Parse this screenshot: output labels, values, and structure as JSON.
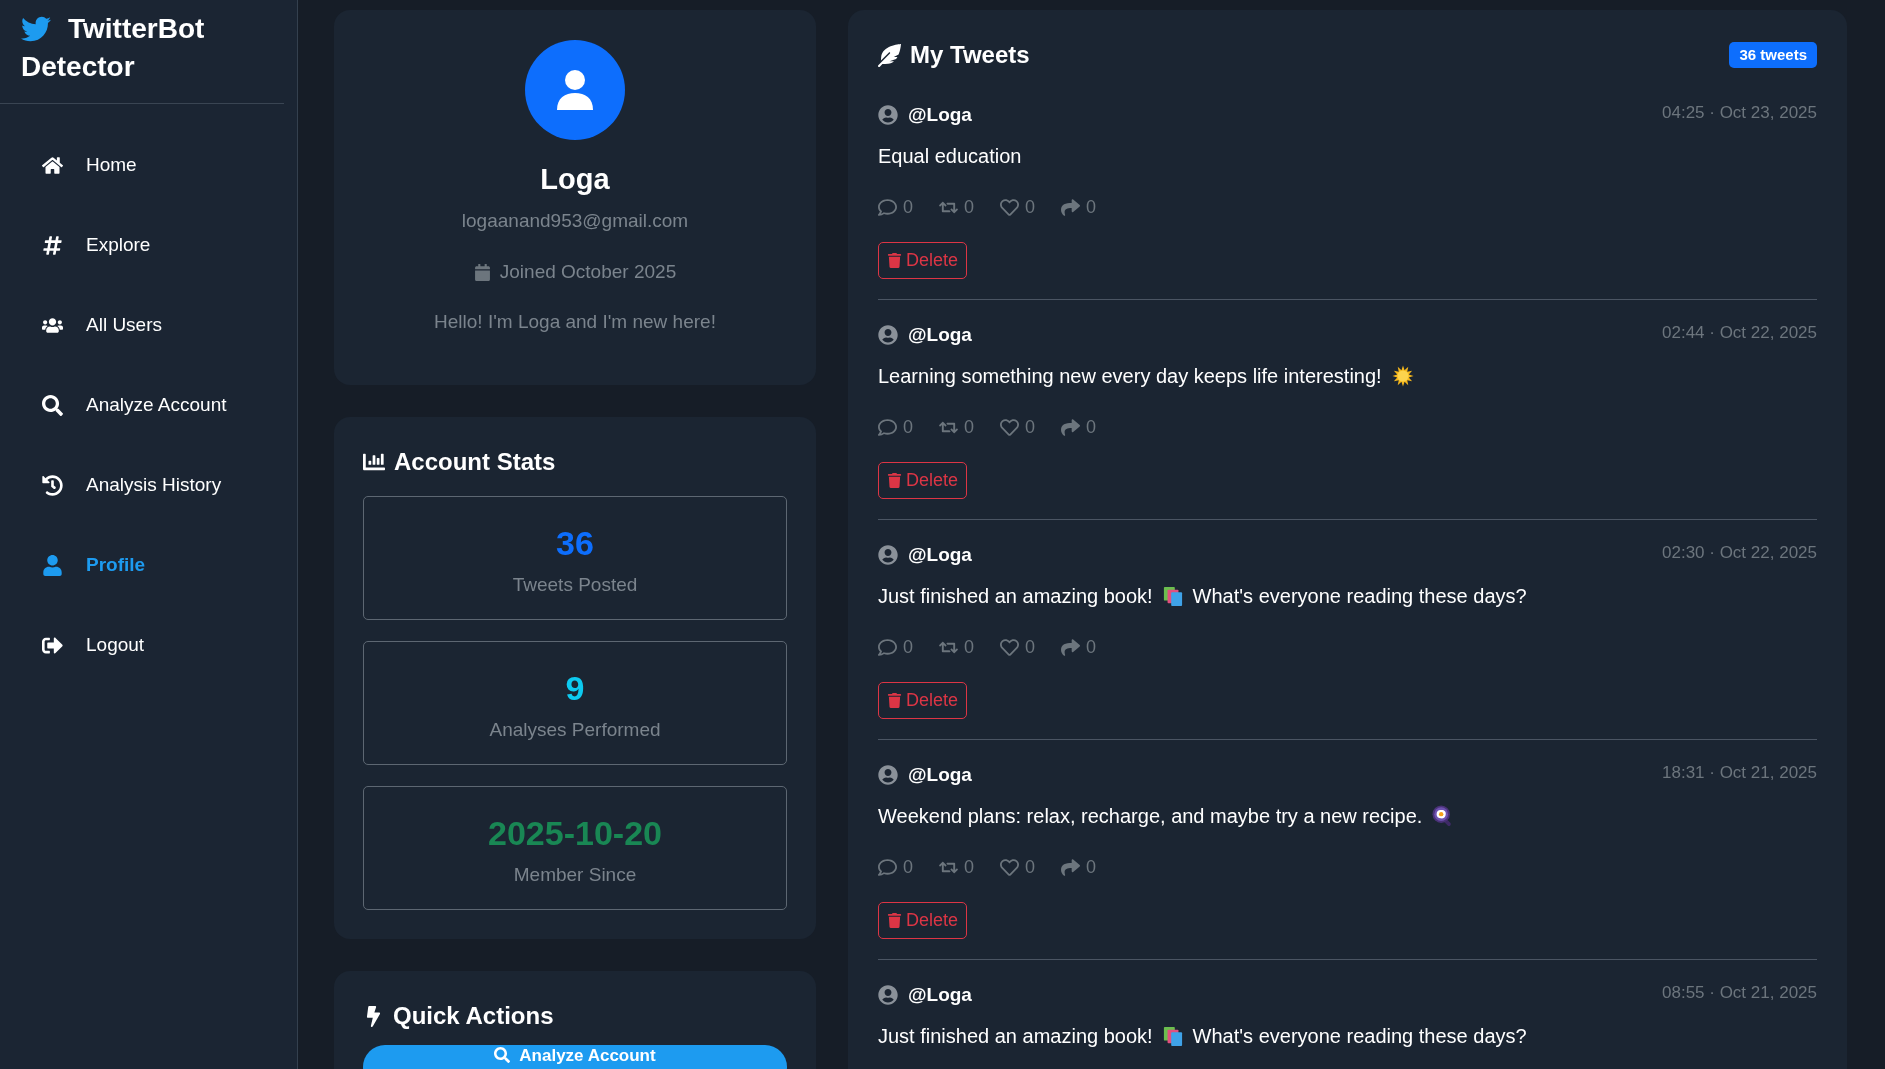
{
  "sidebar": {
    "brand": {
      "lines": [
        "TwitterBot",
        "Detector"
      ]
    },
    "nav": [
      {
        "kind": "home",
        "label": "Home",
        "selected": false
      },
      {
        "kind": "explore",
        "label": "Explore",
        "selected": false
      },
      {
        "kind": "users",
        "label": "All Users",
        "selected": false
      },
      {
        "kind": "analyze",
        "label": "Analyze Account",
        "selected": false
      },
      {
        "kind": "history",
        "label": "Analysis History",
        "selected": false
      },
      {
        "kind": "profile",
        "label": "Profile",
        "selected": true
      },
      {
        "kind": "logout",
        "label": "Logout",
        "selected": false
      }
    ]
  },
  "profile": {
    "name": "Loga",
    "email": "logaanand953@gmail.com",
    "joined": "Joined October 2025",
    "bio": "Hello! I'm Loga and I'm new here!"
  },
  "stats": {
    "title": "Account Stats",
    "items": [
      {
        "value": "36",
        "label": "Tweets Posted",
        "color": "#0d6efd"
      },
      {
        "value": "9",
        "label": "Analyses Performed",
        "color": "#0dcaf0"
      },
      {
        "value": "2025-10-20",
        "label": "Member Since",
        "color": "#198754"
      }
    ]
  },
  "quick_actions": {
    "title": "Quick Actions",
    "buttons": [
      {
        "kind": "analyze",
        "label": "Analyze Account"
      }
    ]
  },
  "tweets": {
    "title": "My Tweets",
    "badge": "36 tweets",
    "items": [
      {
        "handle": "@Loga",
        "time": "04:25 · Oct 23, 2025",
        "content": [
          {
            "kind": "text",
            "text": "Equal education"
          }
        ],
        "actions": [
          {
            "kind": "reply",
            "count": "0"
          },
          {
            "kind": "retweet",
            "count": "0"
          },
          {
            "kind": "like",
            "count": "0"
          },
          {
            "kind": "share",
            "count": "0"
          }
        ],
        "delete": "Delete"
      },
      {
        "handle": "@Loga",
        "time": "02:44 · Oct 22, 2025",
        "content": [
          {
            "kind": "text",
            "text": "Learning something new every day keeps life interesting!"
          },
          {
            "kind": "star"
          }
        ],
        "actions": [
          {
            "kind": "reply",
            "count": "0"
          },
          {
            "kind": "retweet",
            "count": "0"
          },
          {
            "kind": "like",
            "count": "0"
          },
          {
            "kind": "share",
            "count": "0"
          }
        ],
        "delete": "Delete"
      },
      {
        "handle": "@Loga",
        "time": "02:30 · Oct 22, 2025",
        "content": [
          {
            "kind": "text",
            "text": "Just finished an amazing book!"
          },
          {
            "kind": "books"
          },
          {
            "kind": "text",
            "text": "What's everyone reading these days?"
          }
        ],
        "actions": [
          {
            "kind": "reply",
            "count": "0"
          },
          {
            "kind": "retweet",
            "count": "0"
          },
          {
            "kind": "like",
            "count": "0"
          },
          {
            "kind": "share",
            "count": "0"
          }
        ],
        "delete": "Delete"
      },
      {
        "handle": "@Loga",
        "time": "18:31 · Oct 21, 2025",
        "content": [
          {
            "kind": "text",
            "text": "Weekend plans: relax, recharge, and maybe try a new recipe."
          },
          {
            "kind": "pan"
          }
        ],
        "actions": [
          {
            "kind": "reply",
            "count": "0"
          },
          {
            "kind": "retweet",
            "count": "0"
          },
          {
            "kind": "like",
            "count": "0"
          },
          {
            "kind": "share",
            "count": "0"
          }
        ],
        "delete": "Delete"
      },
      {
        "handle": "@Loga",
        "time": "08:55 · Oct 21, 2025",
        "content": [
          {
            "kind": "text",
            "text": "Just finished an amazing book!"
          },
          {
            "kind": "books"
          },
          {
            "kind": "text",
            "text": "What's everyone reading these days?"
          }
        ]
      }
    ]
  }
}
